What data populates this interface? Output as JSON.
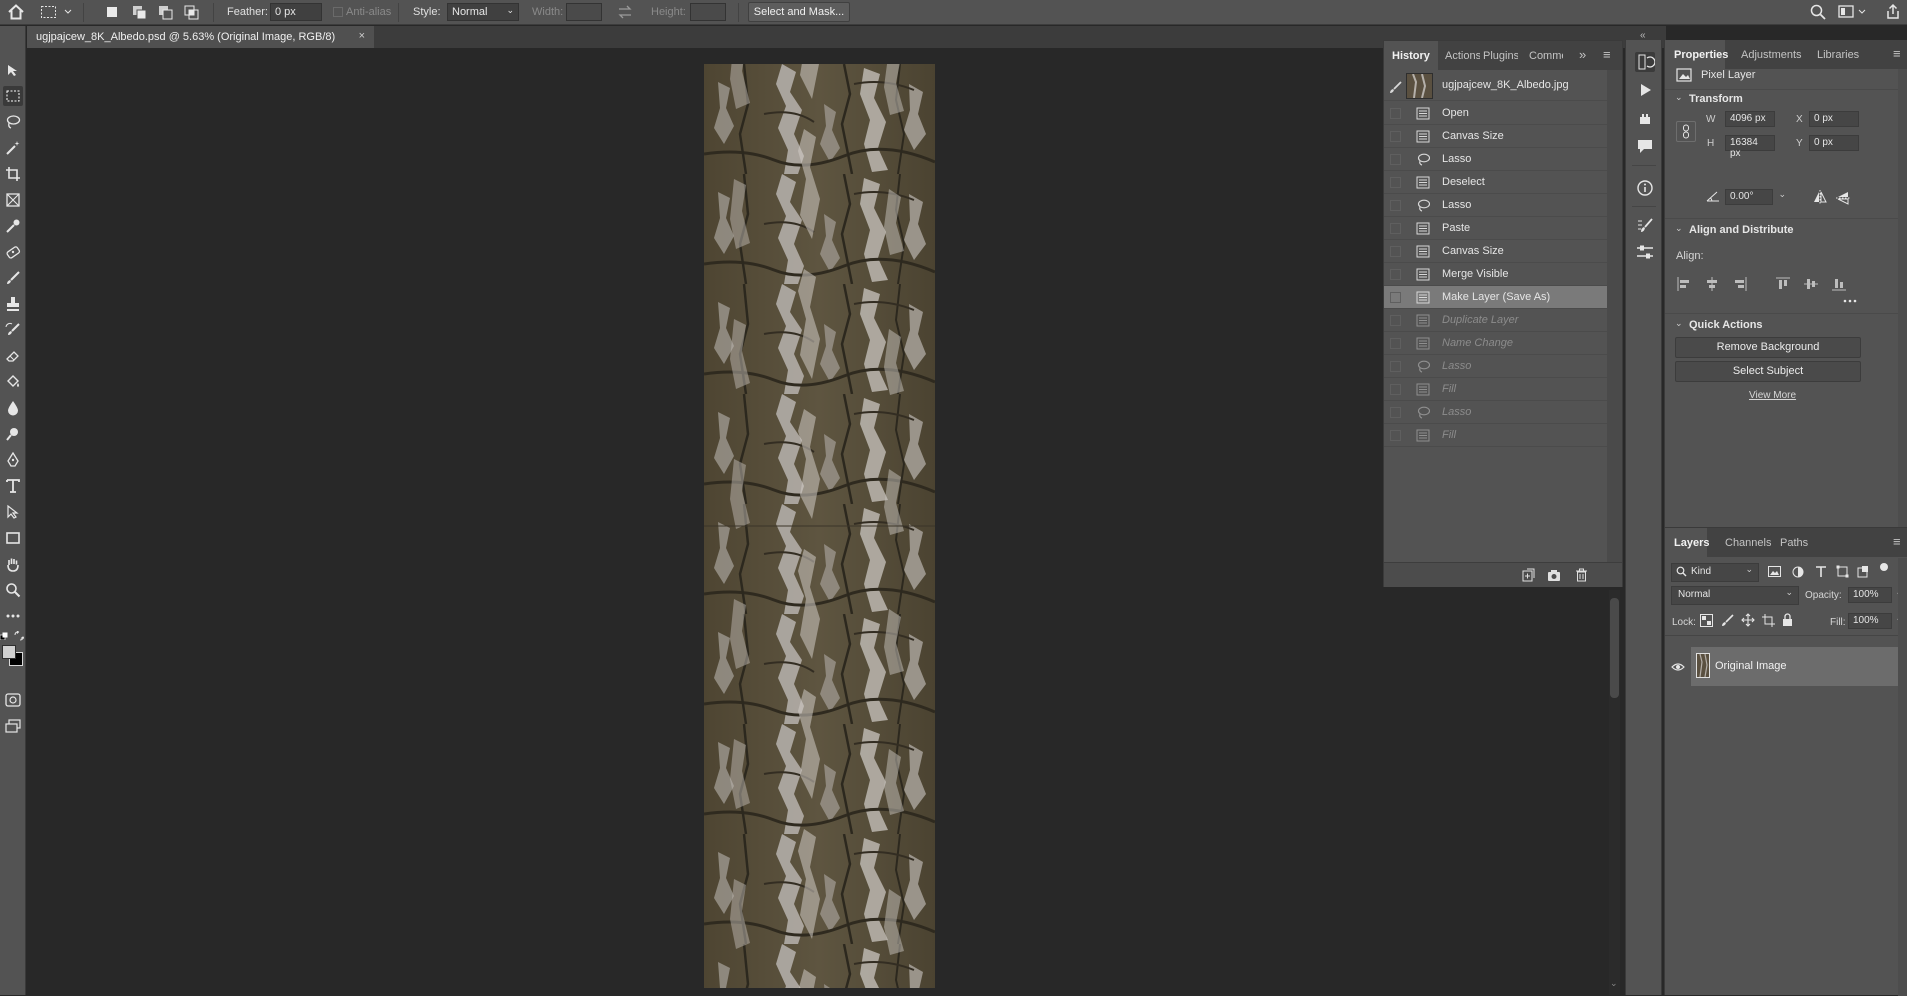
{
  "options_bar": {
    "feather_label": "Feather:",
    "feather_value": "0 px",
    "anti_alias_label": "Anti-alias",
    "style_label": "Style:",
    "style_value": "Normal",
    "width_label": "Width:",
    "height_label": "Height:",
    "select_mask_label": "Select and Mask..."
  },
  "document": {
    "tab_title": "ugjpajcew_8K_Albedo.psd @ 5.63% (Original Image, RGB/8)",
    "close_glyph": "×"
  },
  "history_panel": {
    "tabs": [
      "History",
      "Actions",
      "Plugins",
      "Comments"
    ],
    "active_tab": "History",
    "snapshot_name": "ugjpajcew_8K_Albedo.jpg",
    "steps": [
      {
        "label": "Open",
        "icon": "document-icon",
        "state": "done"
      },
      {
        "label": "Canvas Size",
        "icon": "document-icon",
        "state": "done"
      },
      {
        "label": "Lasso",
        "icon": "lasso-icon",
        "state": "done"
      },
      {
        "label": "Deselect",
        "icon": "document-icon",
        "state": "done"
      },
      {
        "label": "Lasso",
        "icon": "lasso-icon",
        "state": "done"
      },
      {
        "label": "Paste",
        "icon": "document-icon",
        "state": "done"
      },
      {
        "label": "Canvas Size",
        "icon": "document-icon",
        "state": "done"
      },
      {
        "label": "Merge Visible",
        "icon": "document-icon",
        "state": "done"
      },
      {
        "label": "Make Layer (Save As)",
        "icon": "document-icon",
        "state": "selected"
      },
      {
        "label": "Duplicate Layer",
        "icon": "document-icon",
        "state": "undone"
      },
      {
        "label": "Name Change",
        "icon": "document-icon",
        "state": "undone"
      },
      {
        "label": "Lasso",
        "icon": "lasso-icon",
        "state": "undone"
      },
      {
        "label": "Fill",
        "icon": "document-icon",
        "state": "undone"
      },
      {
        "label": "Lasso",
        "icon": "lasso-icon",
        "state": "undone"
      },
      {
        "label": "Fill",
        "icon": "document-icon",
        "state": "undone"
      }
    ]
  },
  "properties_panel": {
    "tabs": [
      "Properties",
      "Adjustments",
      "Libraries"
    ],
    "active_tab": "Properties",
    "layer_type": "Pixel Layer",
    "transform_title": "Transform",
    "w_label": "W",
    "w_value": "4096 px",
    "h_label": "H",
    "h_value": "16384 px",
    "x_label": "X",
    "x_value": "0 px",
    "y_label": "Y",
    "y_value": "0 px",
    "angle_value": "0.00°",
    "align_title": "Align and Distribute",
    "align_label": "Align:",
    "quick_actions_title": "Quick Actions",
    "remove_bg_label": "Remove Background",
    "select_subject_label": "Select Subject",
    "view_more_label": "View More"
  },
  "layers_panel": {
    "tabs": [
      "Layers",
      "Channels",
      "Paths"
    ],
    "active_tab": "Layers",
    "filter_kind": "Kind",
    "blend_mode": "Normal",
    "opacity_label": "Opacity:",
    "opacity_value": "100%",
    "lock_label": "Lock:",
    "fill_label": "Fill:",
    "fill_value": "100%",
    "layers": [
      {
        "name": "Original Image",
        "visible": true
      }
    ]
  },
  "colors": {
    "chrome": "#535353",
    "canvas_bg": "#282828",
    "selected_row": "#7a7a7a",
    "foreground": "#d0d0d0",
    "background": "#000000"
  }
}
